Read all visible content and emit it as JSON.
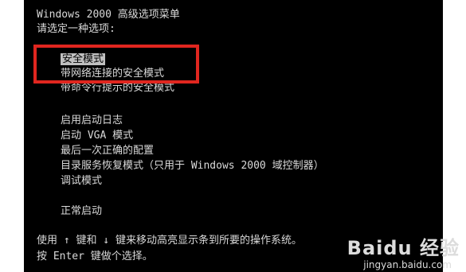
{
  "header": {
    "title": "Windows 2000 高级选项菜单",
    "prompt": "请选定一种选项:"
  },
  "menu": {
    "selected_index": 0,
    "items": [
      "安全模式",
      "带网络连接的安全模式",
      "带命令行提示的安全模式",
      "启用启动日志",
      "启动 VGA 模式",
      "最后一次正确的配置",
      "目录服务恢复模式（只用于 Windows 2000 域控制器）",
      "调试模式",
      "正常启动"
    ]
  },
  "footer": {
    "instruction1": "使用 ↑ 键和 ↓ 键来移动高亮显示条到所要的操作系统。",
    "instruction2": "按 Enter 键做个选择。"
  },
  "watermark": {
    "logo": "Baidu 经验",
    "url": "jingyan.baidu.com"
  },
  "colors": {
    "screen_background": "#000000",
    "text": "#d9d9d9",
    "selection_background": "#c0c0c0",
    "highlight_border": "#e0261f"
  }
}
